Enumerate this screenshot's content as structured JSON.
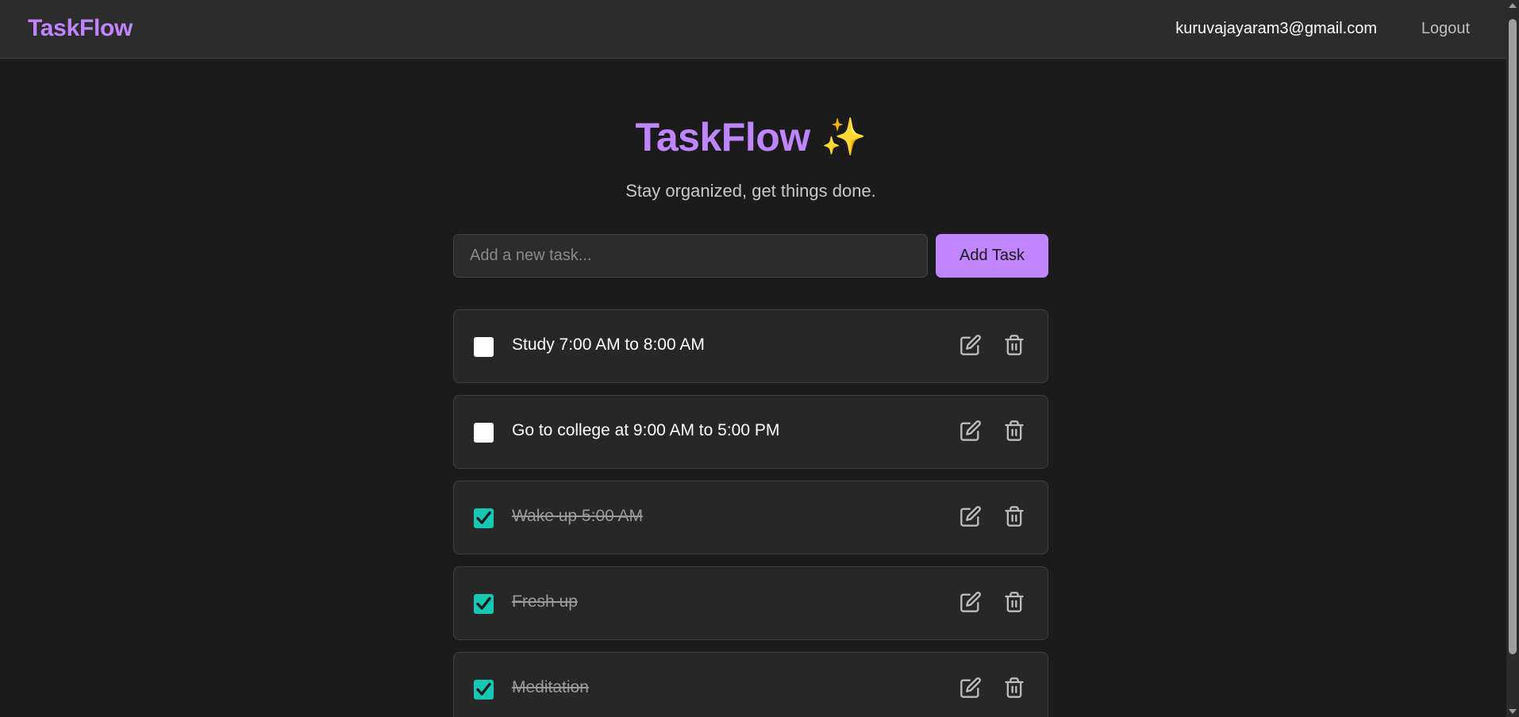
{
  "header": {
    "brand": "TaskFlow",
    "user_email": "kuruvajayaram3@gmail.com",
    "logout_label": "Logout"
  },
  "hero": {
    "title": "TaskFlow",
    "title_emoji": "✨",
    "subtitle": "Stay organized, get things done."
  },
  "new_task": {
    "value": "",
    "placeholder": "Add a new task...",
    "add_label": "Add Task"
  },
  "tasks": [
    {
      "text": "Study 7:00 AM to 8:00 AM",
      "completed": false
    },
    {
      "text": "Go to college at 9:00 AM to 5:00 PM",
      "completed": false
    },
    {
      "text": "Wake up 5:00 AM",
      "completed": true
    },
    {
      "text": "Fresh up",
      "completed": true
    },
    {
      "text": "Meditation",
      "completed": true
    }
  ],
  "icons": {
    "edit": "edit-icon",
    "delete": "trash-icon",
    "check": "check-icon"
  },
  "colors": {
    "accent": "#c084fc",
    "checked": "#14c8b4",
    "background": "#1b1b1b",
    "card": "#272727",
    "topbar": "#2c2c2c"
  }
}
